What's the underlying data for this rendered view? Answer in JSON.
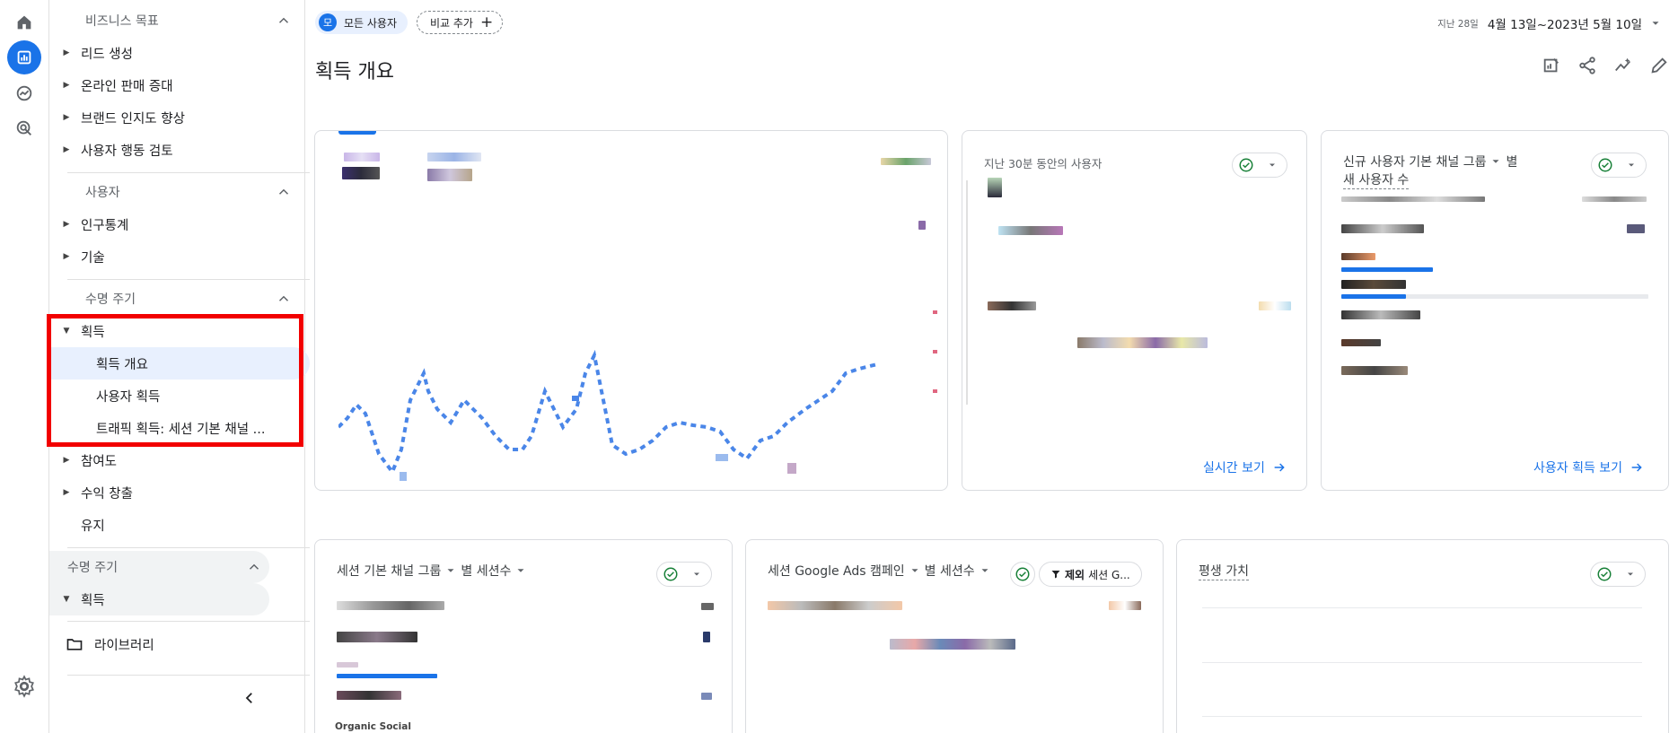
{
  "header": {
    "segment_avatar": "모",
    "segment_label": "모든 사용자",
    "compare_label": "비교 추가",
    "date_prefix": "지난 28일",
    "date_range": "4월 13일~2023년 5월 10일"
  },
  "page": {
    "title": "획득 개요"
  },
  "nav": {
    "sections": [
      {
        "label": "비즈니스 목표"
      },
      {
        "label": "사용자"
      },
      {
        "label": "수명 주기"
      },
      {
        "label": "수명 주기"
      }
    ],
    "goal_items": [
      "리드 생성",
      "온라인 판매 증대",
      "브랜드 인지도 향상",
      "사용자 행동 검토"
    ],
    "user_items": [
      "인구통계",
      "기술"
    ],
    "lifecycle": {
      "acq_label": "획득",
      "sub_items": [
        "획득 개요",
        "사용자 획득",
        "트래픽 획득: 세션 기본 채널 ..."
      ],
      "engage_label": "참여도",
      "monetize_label": "수익 창출",
      "retention_label": "유지"
    },
    "lifecycle2": {
      "acq_label": "획득"
    },
    "library_label": "라이브러리"
  },
  "cards": {
    "realtime": {
      "title": "지난 30분 동안의 사용자",
      "link": "실시간 보기"
    },
    "new_users": {
      "title_line1": "신규 사용자 기본 채널 그룹",
      "title_by": "별",
      "title_line2": "새 사용자 수",
      "link": "사용자 획득 보기"
    },
    "sessions": {
      "dim": "세션 기본 채널 그룹",
      "by": "별 세션수",
      "bottom_text": "Organic Social"
    },
    "ads": {
      "dim": "세션 Google Ads 캠페인",
      "by": "별 세션수",
      "filter_bold": "제외",
      "filter_rest": "세션 G..."
    },
    "ltv": {
      "title": "평생 가치"
    }
  },
  "colors": {
    "accent": "#1a73e8",
    "highlight": "#f20000",
    "check": "#188038"
  }
}
